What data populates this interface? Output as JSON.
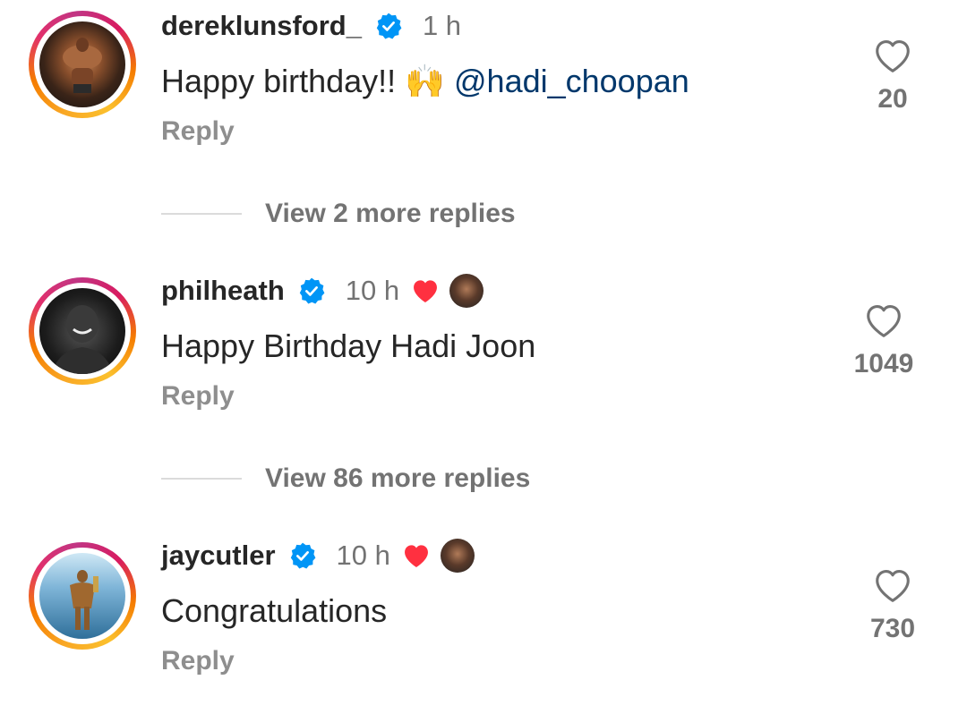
{
  "comments": [
    {
      "username": "dereklunsford_",
      "time": "1 h",
      "text_before": "Happy birthday!! ",
      "emoji": "🙌",
      "mention": "@hadi_choopan",
      "reply_label": "Reply",
      "likes": "20",
      "view_more": "View 2 more replies"
    },
    {
      "username": "philheath",
      "time": "10 h",
      "text": "Happy Birthday Hadi Joon",
      "reply_label": "Reply",
      "likes": "1049",
      "view_more": "View 86 more replies"
    },
    {
      "username": "jaycutler",
      "time": "10 h",
      "text": "Congratulations",
      "reply_label": "Reply",
      "likes": "730"
    }
  ],
  "colors": {
    "verified": "#0095f6",
    "liked_heart": "#ff3040",
    "mention": "#00376b",
    "secondary_text": "#737373"
  },
  "icons": [
    "verified-badge-icon",
    "heart-outline-icon",
    "heart-filled-icon"
  ]
}
